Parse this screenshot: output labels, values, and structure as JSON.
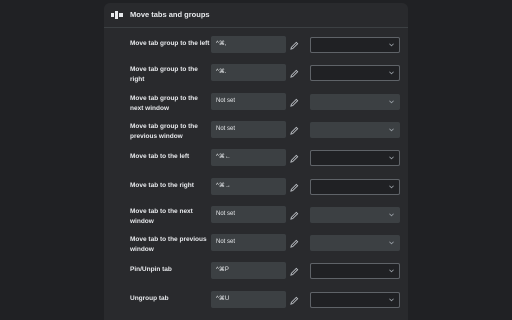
{
  "section": {
    "title": "Move tabs and groups",
    "icon": "move-tabs-icon"
  },
  "rows": [
    {
      "label": "Move tab group to the left",
      "shortcut": "^⌘,",
      "dropdown_enabled": true
    },
    {
      "label": "Move tab group to the right",
      "shortcut": "^⌘.",
      "dropdown_enabled": true
    },
    {
      "label": "Move tab group to the next window",
      "shortcut": "Not set",
      "dropdown_enabled": false
    },
    {
      "label": "Move tab group to the previous window",
      "shortcut": "Not set",
      "dropdown_enabled": false
    },
    {
      "label": "Move tab to the left",
      "shortcut": "^⌘←",
      "dropdown_enabled": true
    },
    {
      "label": "Move tab to the right",
      "shortcut": "^⌘→",
      "dropdown_enabled": true
    },
    {
      "label": "Move tab to the next window",
      "shortcut": "Not set",
      "dropdown_enabled": false
    },
    {
      "label": "Move tab to the previous window",
      "shortcut": "Not set",
      "dropdown_enabled": false
    },
    {
      "label": "Pin/Unpin tab",
      "shortcut": "^⌘P",
      "dropdown_enabled": true
    },
    {
      "label": "Ungroup tab",
      "shortcut": "^⌘U",
      "dropdown_enabled": true
    }
  ],
  "colors": {
    "background": "#202124",
    "panel": "#292a2d",
    "field": "#3c4043",
    "text": "#e8eaed"
  }
}
